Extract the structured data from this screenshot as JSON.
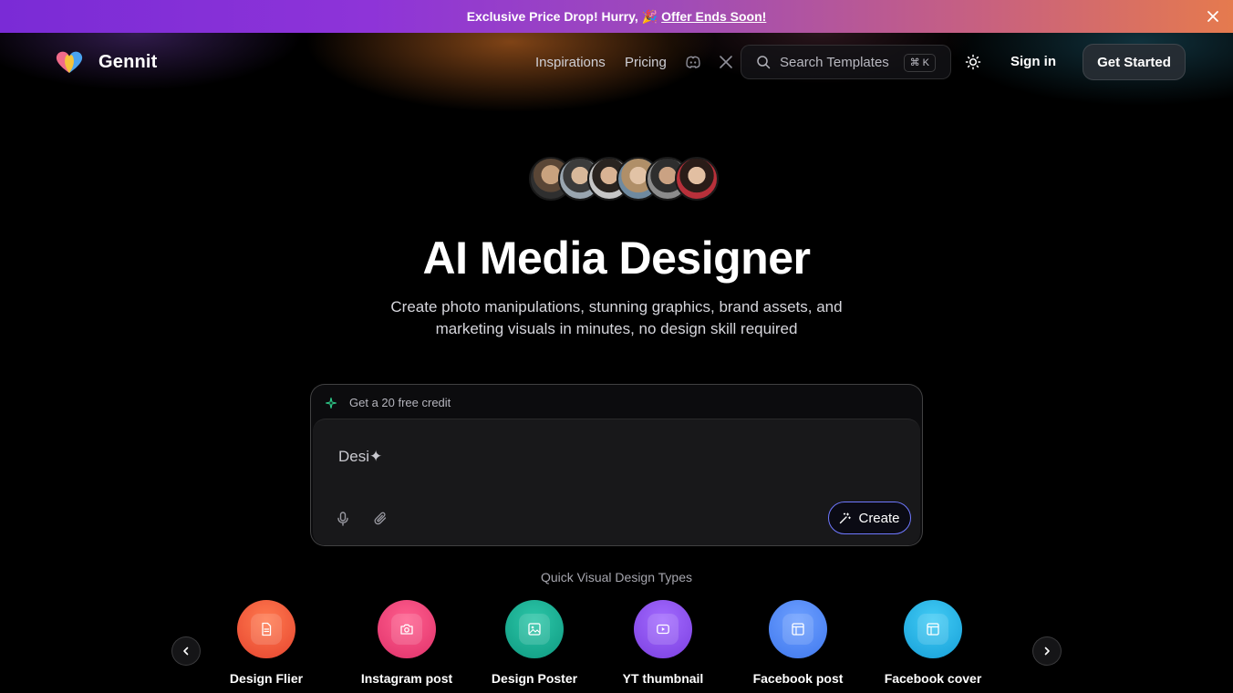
{
  "promo": {
    "text": "Exclusive Price Drop! Hurry,",
    "emoji": "🎉",
    "link": "Offer Ends Soon!"
  },
  "header": {
    "brand": "Gennit",
    "nav": {
      "inspirations": "Inspirations",
      "pricing": "Pricing"
    },
    "search": {
      "placeholder": "Search Templates",
      "shortcut": "⌘ K"
    },
    "sign_in": "Sign in",
    "get_started": "Get Started"
  },
  "hero": {
    "title": "AI Media Designer",
    "subtitle": "Create photo manipulations, stunning graphics, brand assets, and marketing visuals in minutes, no design skill required"
  },
  "prompt": {
    "credit": "Get a 20 free credit",
    "text": "Desi✦",
    "create_label": "Create"
  },
  "quick_types": {
    "title": "Quick Visual Design Types",
    "items": [
      {
        "label": "Design Flier",
        "icon": "document-icon",
        "color": "#f0533b"
      },
      {
        "label": "Instagram post",
        "icon": "camera-icon",
        "color": "#ea3f74"
      },
      {
        "label": "Design Poster",
        "icon": "image-icon",
        "color": "#15a88f"
      },
      {
        "label": "YT thumbnail",
        "icon": "play-icon",
        "color": "#8a4de8"
      },
      {
        "label": "Facebook post",
        "icon": "layout-icon",
        "color": "#4d86f5"
      },
      {
        "label": "Facebook cover",
        "icon": "layout-icon",
        "color": "#22b3e6"
      }
    ]
  }
}
